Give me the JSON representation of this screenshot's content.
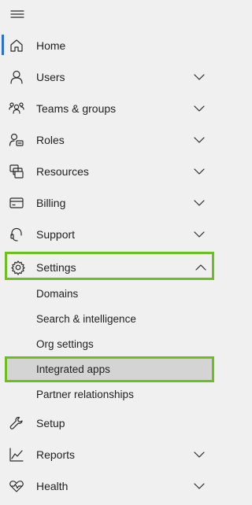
{
  "nav": {
    "menu_icon": "hamburger-icon",
    "items": [
      {
        "label": "Home",
        "icon": "home-icon",
        "expandable": false
      },
      {
        "label": "Users",
        "icon": "person-icon",
        "expandable": true
      },
      {
        "label": "Teams & groups",
        "icon": "people-group-icon",
        "expandable": true
      },
      {
        "label": "Roles",
        "icon": "person-key-icon",
        "expandable": true
      },
      {
        "label": "Resources",
        "icon": "resources-icon",
        "expandable": true
      },
      {
        "label": "Billing",
        "icon": "credit-card-icon",
        "expandable": true
      },
      {
        "label": "Support",
        "icon": "headset-icon",
        "expandable": true
      },
      {
        "label": "Settings",
        "icon": "gear-icon",
        "expandable": true,
        "expanded": true,
        "children": [
          {
            "label": "Domains"
          },
          {
            "label": "Search & intelligence"
          },
          {
            "label": "Org settings"
          },
          {
            "label": "Integrated apps",
            "selected": true
          },
          {
            "label": "Partner relationships"
          }
        ]
      },
      {
        "label": "Setup",
        "icon": "wrench-icon",
        "expandable": false
      },
      {
        "label": "Reports",
        "icon": "chart-icon",
        "expandable": true
      },
      {
        "label": "Health",
        "icon": "heart-pulse-icon",
        "expandable": true
      }
    ],
    "active_item": "Home",
    "highlight_color": "#6bbf1f",
    "active_indicator_color": "#2b6fd6"
  }
}
